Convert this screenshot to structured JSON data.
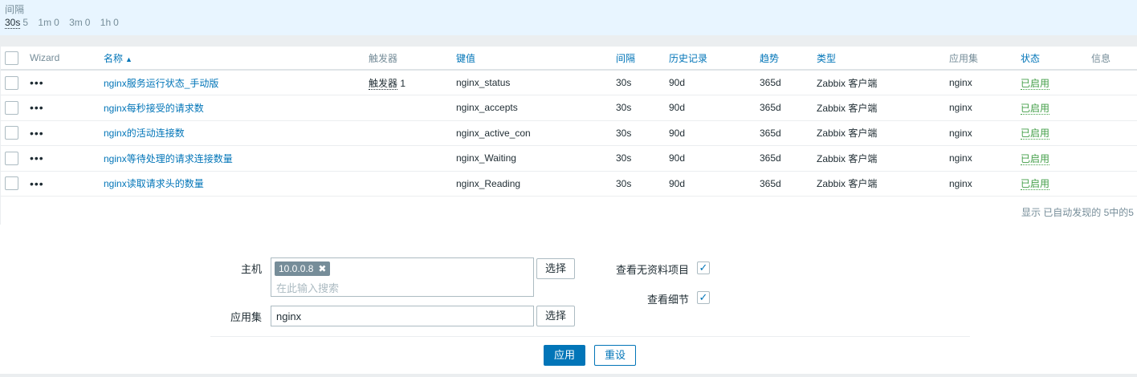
{
  "interval_filter": {
    "title": "间隔",
    "options": [
      {
        "key": "30s",
        "count": "5",
        "active": true
      },
      {
        "key": "1m",
        "count": "0",
        "active": false
      },
      {
        "key": "3m",
        "count": "0",
        "active": false
      },
      {
        "key": "1h",
        "count": "0",
        "active": false
      }
    ]
  },
  "table": {
    "headers": {
      "wizard": "Wizard",
      "name": "名称",
      "sort_arrow": "▲",
      "triggers": "触发器",
      "key": "键值",
      "interval": "间隔",
      "history": "历史记录",
      "trends": "趋势",
      "type": "类型",
      "applications": "应用集",
      "status": "状态",
      "info": "信息"
    },
    "rows": [
      {
        "name": "nginx服务运行状态_手动版",
        "trigger_label": "触发器",
        "trigger_count": "1",
        "key": "nginx_status",
        "interval": "30s",
        "history": "90d",
        "trends": "365d",
        "type": "Zabbix 客户端",
        "app": "nginx",
        "status": "已启用"
      },
      {
        "name": "nginx每秒接受的请求数",
        "trigger_label": "",
        "trigger_count": "",
        "key": "nginx_accepts",
        "interval": "30s",
        "history": "90d",
        "trends": "365d",
        "type": "Zabbix 客户端",
        "app": "nginx",
        "status": "已启用"
      },
      {
        "name": "nginx的活动连接数",
        "trigger_label": "",
        "trigger_count": "",
        "key": "nginx_active_con",
        "interval": "30s",
        "history": "90d",
        "trends": "365d",
        "type": "Zabbix 客户端",
        "app": "nginx",
        "status": "已启用"
      },
      {
        "name": "nginx等待处理的请求连接数量",
        "trigger_label": "",
        "trigger_count": "",
        "key": "nginx_Waiting",
        "interval": "30s",
        "history": "90d",
        "trends": "365d",
        "type": "Zabbix 客户端",
        "app": "nginx",
        "status": "已启用"
      },
      {
        "name": "nginx读取请求头的数量",
        "trigger_label": "",
        "trigger_count": "",
        "key": "nginx_Reading",
        "interval": "30s",
        "history": "90d",
        "trends": "365d",
        "type": "Zabbix 客户端",
        "app": "nginx",
        "status": "已启用"
      }
    ],
    "wizard_glyph": "•••",
    "footer": "显示 已自动发现的 5中的5"
  },
  "filter_form": {
    "host_label": "主机",
    "host_chip": "10.0.0.8",
    "chip_remove": "✖",
    "host_placeholder": "在此输入搜索",
    "select_label": "选择",
    "app_label": "应用集",
    "app_value": "nginx",
    "show_no_data_label": "查看无资料项目",
    "show_details_label": "查看细节",
    "check_glyph": "✓",
    "apply_label": "应用",
    "reset_label": "重设"
  },
  "colors": {
    "link": "#0275b8",
    "enabled": "#429e47",
    "interval_bg": "#e8f5ff"
  }
}
